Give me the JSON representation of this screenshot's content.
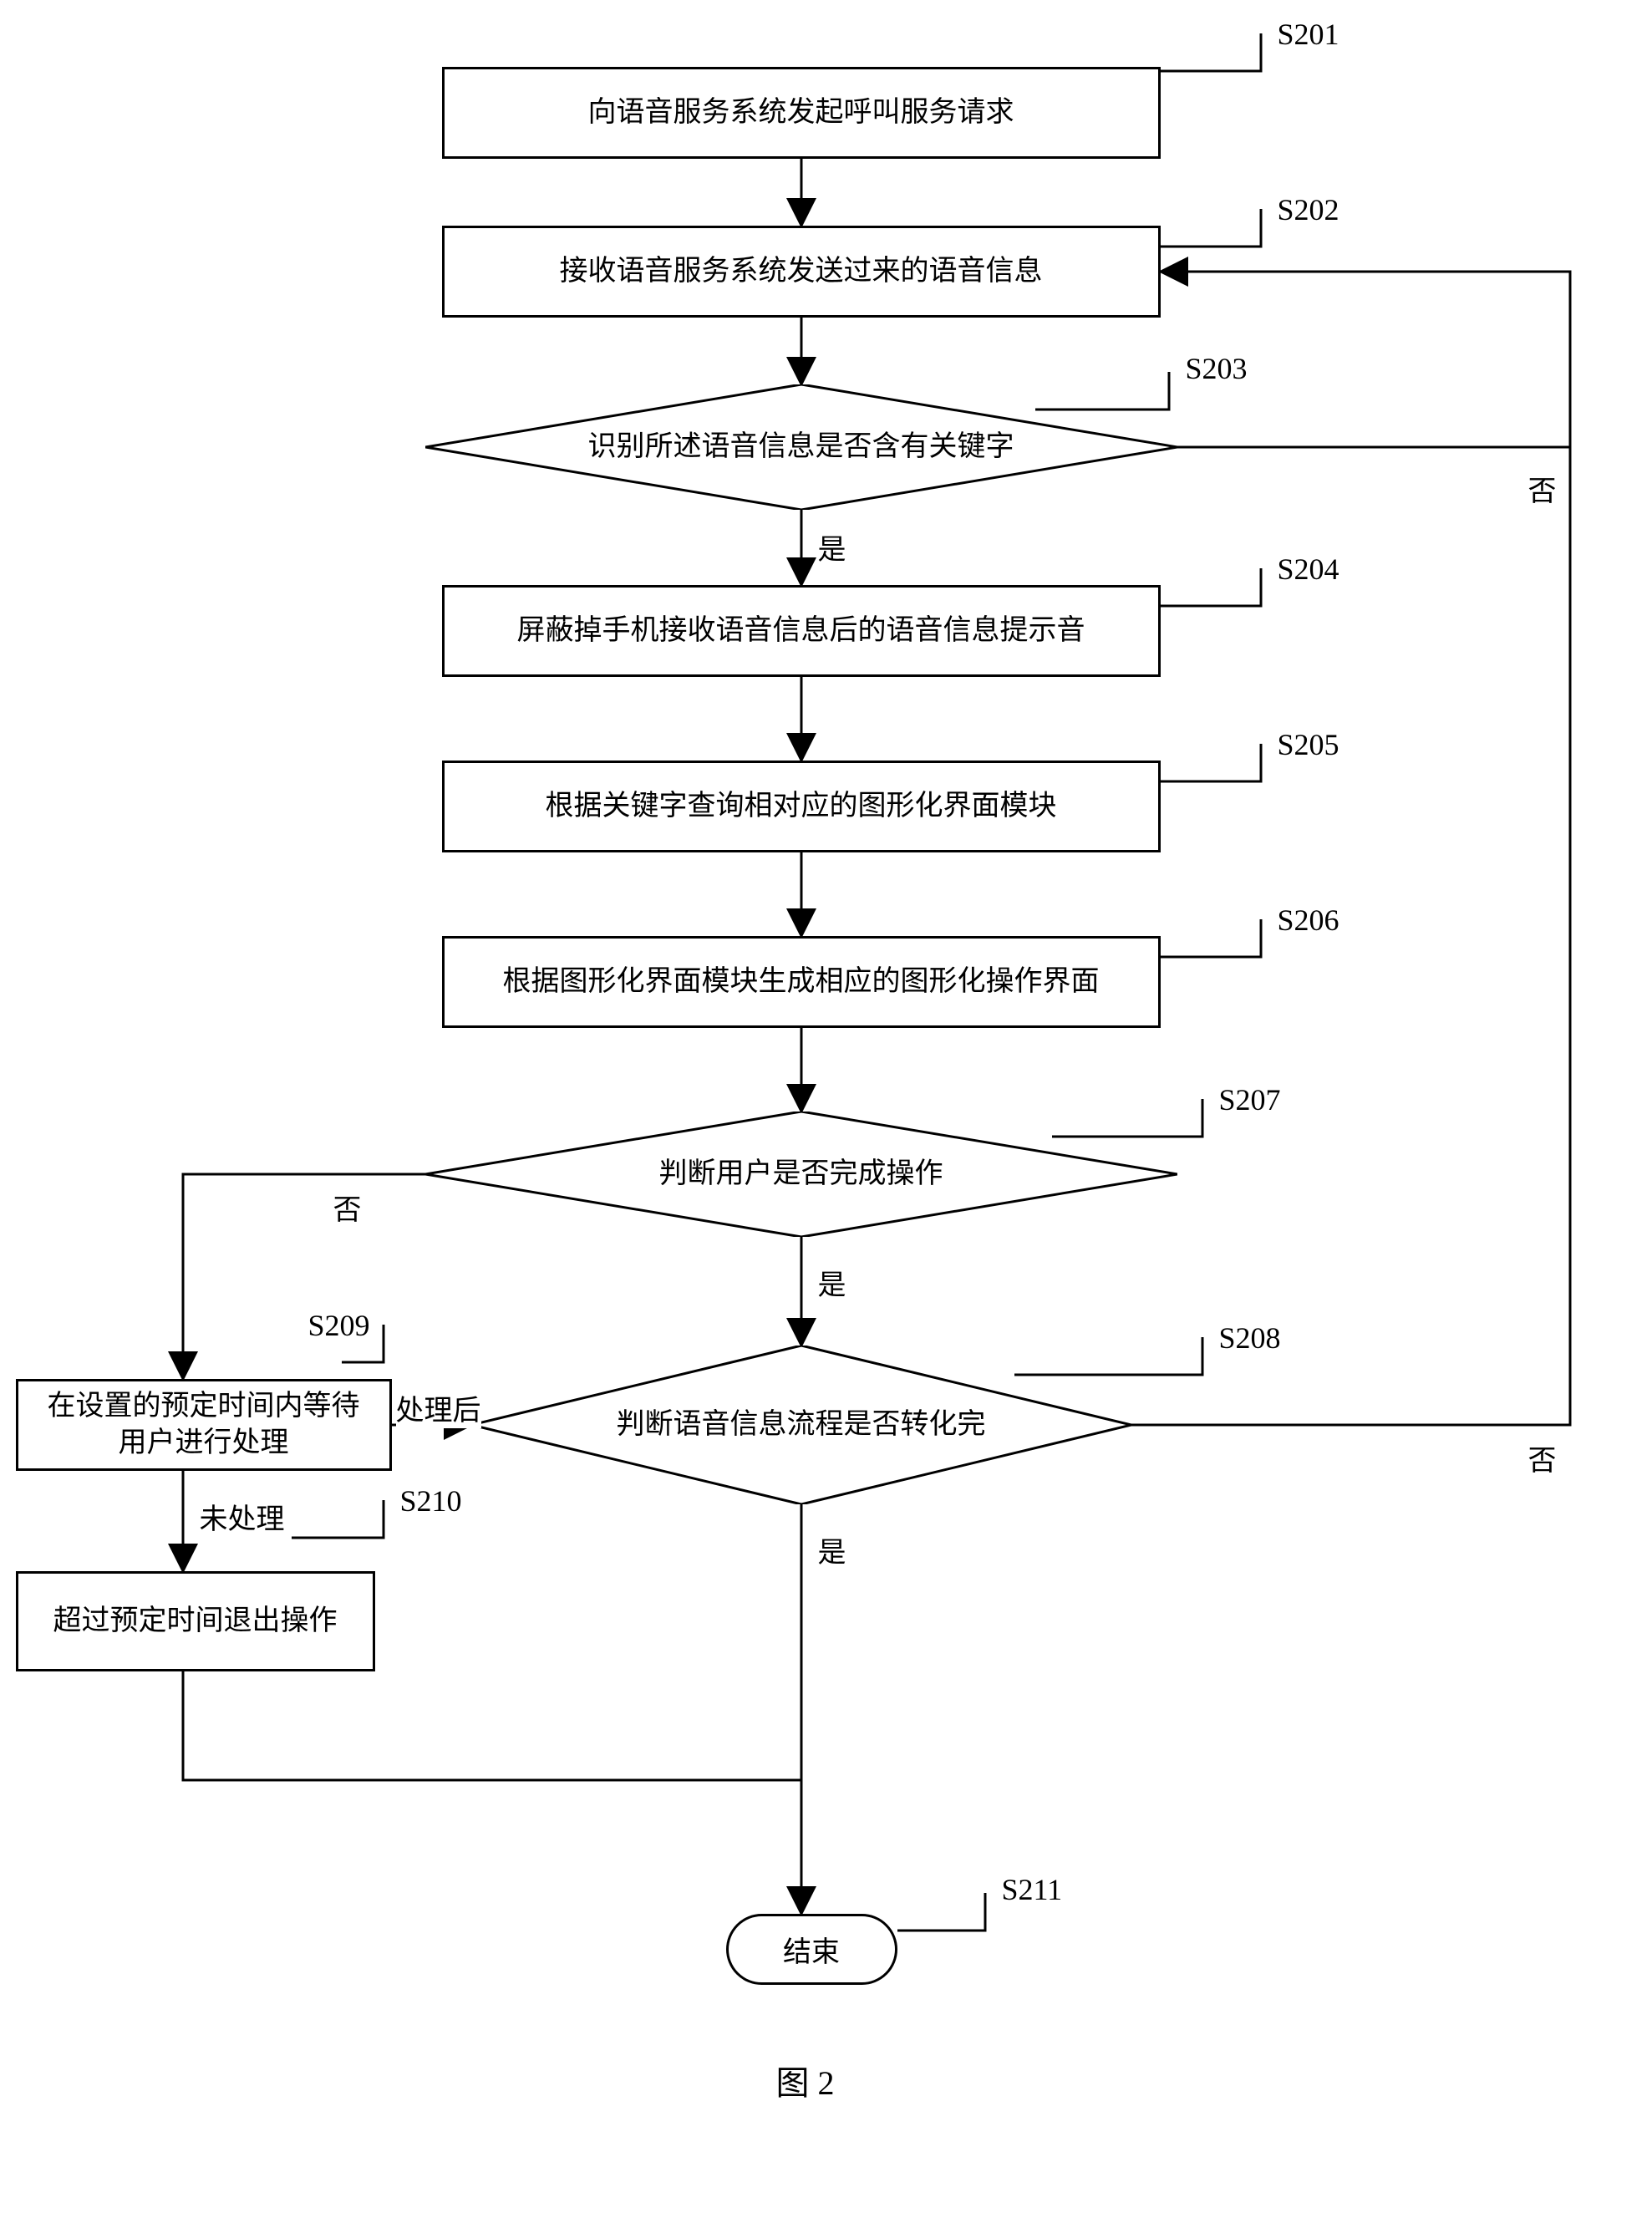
{
  "steps": {
    "s201": {
      "num": "S201",
      "text": "向语音服务系统发起呼叫服务请求"
    },
    "s202": {
      "num": "S202",
      "text": "接收语音服务系统发送过来的语音信息"
    },
    "s203": {
      "num": "S203",
      "text": "识别所述语音信息是否含有关键字"
    },
    "s204": {
      "num": "S204",
      "text": "屏蔽掉手机接收语音信息后的语音信息提示音"
    },
    "s205": {
      "num": "S205",
      "text": "根据关键字查询相对应的图形化界面模块"
    },
    "s206": {
      "num": "S206",
      "text": "根据图形化界面模块生成相应的图形化操作界面"
    },
    "s207": {
      "num": "S207",
      "text": "判断用户是否完成操作"
    },
    "s208": {
      "num": "S208",
      "text": "判断语音信息流程是否转化完"
    },
    "s209": {
      "num": "S209",
      "text": "在设置的预定时间内等待用户进行处理"
    },
    "s210": {
      "num": "S210",
      "text": "超过预定时间退出操作"
    },
    "s211": {
      "num": "S211",
      "text": "结束"
    }
  },
  "labels": {
    "yes": "是",
    "no": "否",
    "processed": "处理后",
    "unprocessed": "未处理"
  },
  "figure": "图 2"
}
